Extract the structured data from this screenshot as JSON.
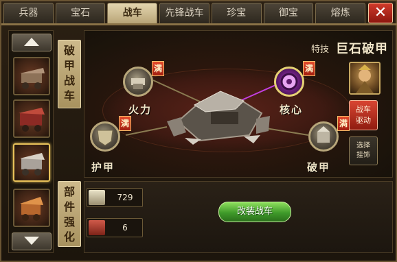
{
  "tabs": [
    {
      "label": "兵器",
      "active": false
    },
    {
      "label": "宝石",
      "active": false
    },
    {
      "label": "战车",
      "active": true
    },
    {
      "label": "先锋战车",
      "active": false
    },
    {
      "label": "珍宝",
      "active": false
    },
    {
      "label": "御宝",
      "active": false
    },
    {
      "label": "熔炼",
      "active": false
    }
  ],
  "close_label": "✕",
  "side_labels": {
    "top": "破甲战车",
    "bottom": "部件强化"
  },
  "skill": {
    "label": "特技",
    "name": "巨石破甲"
  },
  "parts": {
    "firepower": {
      "label": "火力",
      "badge": "满"
    },
    "core": {
      "label": "核心",
      "badge": "满"
    },
    "armor": {
      "label": "护甲",
      "badge": "满"
    },
    "pierce": {
      "label": "破甲",
      "badge": "满"
    }
  },
  "side_buttons": {
    "drive": "战车驱动",
    "select": "选择挂饰"
  },
  "resources": {
    "material": "729",
    "scroll": "6"
  },
  "modify_button": "改装战车",
  "colors": {
    "active_tab": "#e4d6b0",
    "close": "#c62f22",
    "full_badge": "#c8321c",
    "modify_button": "#4fae32",
    "core_link": "#c23fe0"
  }
}
